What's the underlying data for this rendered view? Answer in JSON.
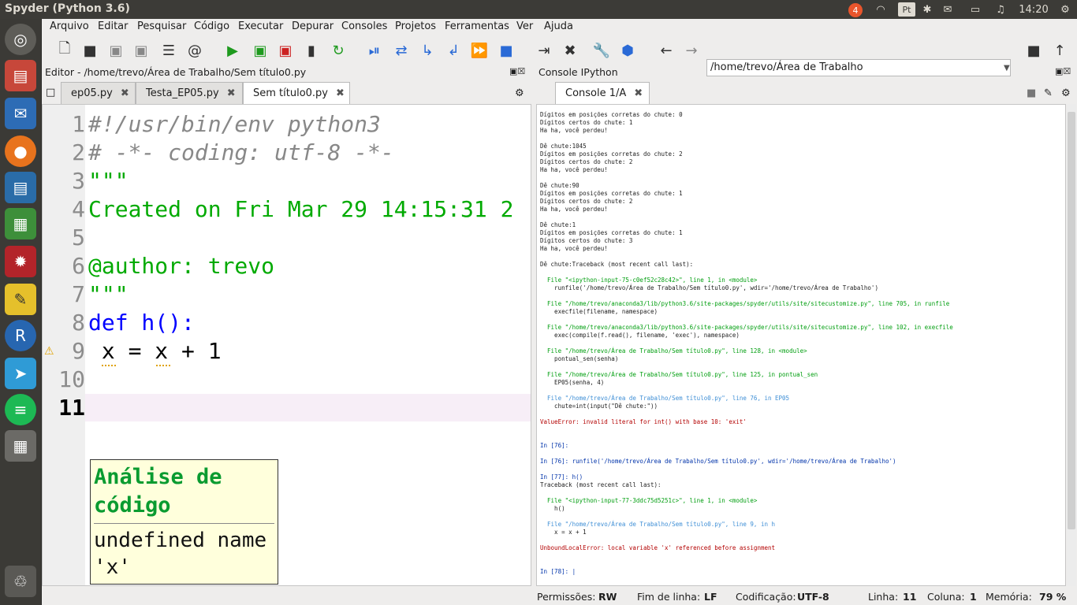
{
  "window_title": "Spyder (Python 3.6)",
  "indicators": {
    "badge": "4",
    "keyboard": "Pt",
    "time": "14:20"
  },
  "menu": [
    "Arquivo",
    "Editar",
    "Pesquisar",
    "Código",
    "Executar",
    "Depurar",
    "Consoles",
    "Projetos",
    "Ferramentas",
    "Ver",
    "Ajuda"
  ],
  "path": "/home/trevo/Área de Trabalho",
  "editor": {
    "header": "Editor - /home/trevo/Área de Trabalho/Sem título0.py",
    "tabs": [
      "ep05.py",
      "Testa_EP05.py",
      "Sem título0.py"
    ],
    "line_numbers": [
      "1",
      "2",
      "3",
      "4",
      "5",
      "6",
      "7",
      "8",
      "9",
      "10",
      "11"
    ],
    "lines": [
      "#!/usr/bin/env python3",
      "# -*- coding: utf-8 -*-",
      "\"\"\"",
      "Created on Fri Mar 29 14:15:31 2",
      "",
      "@author: trevo",
      "\"\"\"",
      "def h():",
      " x = x + 1",
      "",
      ""
    ],
    "tooltip_title": "Análise de código",
    "tooltip_msg": "undefined name 'x'"
  },
  "console": {
    "header": "Console IPython",
    "tab": "Console 1/A",
    "lines": [
      {
        "t": "Dígitos em posições corretas do chute: 0"
      },
      {
        "t": "Dígitos certos do chute: 1"
      },
      {
        "t": "Ha ha, você perdeu!"
      },
      {
        "t": ""
      },
      {
        "t": "Dê chute:1045"
      },
      {
        "t": "Dígitos em posições corretas do chute: 2"
      },
      {
        "t": "Dígitos certos do chute: 2"
      },
      {
        "t": "Ha ha, você perdeu!"
      },
      {
        "t": ""
      },
      {
        "t": "Dê chute:90"
      },
      {
        "t": "Dígitos em posições corretas do chute: 1"
      },
      {
        "t": "Dígitos certos do chute: 2"
      },
      {
        "t": "Ha ha, você perdeu!"
      },
      {
        "t": ""
      },
      {
        "t": "Dê chute:1"
      },
      {
        "t": "Dígitos em posições corretas do chute: 1"
      },
      {
        "t": "Dígitos certos do chute: 3"
      },
      {
        "t": "Ha ha, você perdeu!"
      },
      {
        "t": ""
      },
      {
        "t": "Dê chute:Traceback (most recent call last):"
      },
      {
        "t": ""
      },
      {
        "t": "  File \"<ipython-input-75-c0ef52c28c42>\", line 1, in <module>",
        "c": "cg"
      },
      {
        "t": "    runfile('/home/trevo/Área de Trabalho/Sem título0.py', wdir='/home/trevo/Área de Trabalho')"
      },
      {
        "t": ""
      },
      {
        "t": "  File \"/home/trevo/anaconda3/lib/python3.6/site-packages/spyder/utils/site/sitecustomize.py\", line 705, in runfile",
        "c": "cg"
      },
      {
        "t": "    execfile(filename, namespace)"
      },
      {
        "t": ""
      },
      {
        "t": "  File \"/home/trevo/anaconda3/lib/python3.6/site-packages/spyder/utils/site/sitecustomize.py\", line 102, in execfile",
        "c": "cg"
      },
      {
        "t": "    exec(compile(f.read(), filename, 'exec'), namespace)"
      },
      {
        "t": ""
      },
      {
        "t": "  File \"/home/trevo/Área de Trabalho/Sem título0.py\", line 128, in <module>",
        "c": "cg"
      },
      {
        "t": "    pontual_sen(senha)"
      },
      {
        "t": ""
      },
      {
        "t": "  File \"/home/trevo/Área de Trabalho/Sem título0.py\", line 125, in pontual_sen",
        "c": "cg"
      },
      {
        "t": "    EP05(senha, 4)"
      },
      {
        "t": ""
      },
      {
        "t": "  File \"/home/trevo/Área de Trabalho/Sem título0.py\", line 76, in EP05",
        "c": "cc"
      },
      {
        "t": "    chute=int(input(\"Dê chute:\"))"
      },
      {
        "t": ""
      },
      {
        "t": "ValueError: invalid literal for int() with base 10: 'exit'",
        "c": "cr"
      },
      {
        "t": ""
      },
      {
        "t": ""
      },
      {
        "t": "In [76]:",
        "c": "cp"
      },
      {
        "t": ""
      },
      {
        "t": "In [76]: runfile('/home/trevo/Área de Trabalho/Sem título0.py', wdir='/home/trevo/Área de Trabalho')",
        "c": "cp"
      },
      {
        "t": ""
      },
      {
        "t": "In [77]: h()",
        "c": "cp"
      },
      {
        "t": "Traceback (most recent call last):"
      },
      {
        "t": ""
      },
      {
        "t": "  File \"<ipython-input-77-3ddc75d5251c>\", line 1, in <module>",
        "c": "cg"
      },
      {
        "t": "    h()"
      },
      {
        "t": ""
      },
      {
        "t": "  File \"/home/trevo/Área de Trabalho/Sem título0.py\", line 9, in h",
        "c": "cc"
      },
      {
        "t": "    x = x + 1"
      },
      {
        "t": ""
      },
      {
        "t": "UnboundLocalError: local variable 'x' referenced before assignment",
        "c": "cr"
      },
      {
        "t": ""
      },
      {
        "t": ""
      },
      {
        "t": "In [78]: |",
        "c": "cp"
      },
      {
        "t": ""
      },
      {
        "t": ""
      },
      {
        "t": "In [78]:",
        "c": "cp"
      }
    ]
  },
  "status": {
    "perm_label": "Permissões:",
    "perm": "RW",
    "eol_label": "Fim de linha:",
    "eol": "LF",
    "enc_label": "Codificação:",
    "enc": "UTF-8",
    "line_label": "Linha:",
    "line": "11",
    "col_label": "Coluna:",
    "col": "1",
    "mem_label": "Memória:",
    "mem": "79 %"
  }
}
